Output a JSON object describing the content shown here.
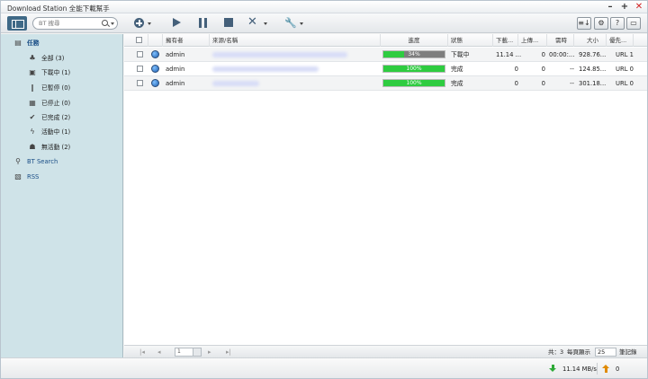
{
  "window": {
    "title": "Download Station 全能下載幫手",
    "controls": [
      "–",
      "+",
      "✕"
    ]
  },
  "toolbar": {
    "search_placeholder": "BT 搜尋",
    "right_buttons": [
      "≡↓",
      "⚙",
      "?",
      "▭"
    ]
  },
  "sidebar": {
    "tasks_header": "任務",
    "items": [
      {
        "label": "全部 (3)",
        "icon": "all-users-icon"
      },
      {
        "label": "下載中 (1)",
        "icon": "downloading-icon"
      },
      {
        "label": "已暫停 (0)",
        "icon": "paused-icon"
      },
      {
        "label": "已停止 (0)",
        "icon": "stopped-icon"
      },
      {
        "label": "已完成 (2)",
        "icon": "check-icon"
      },
      {
        "label": "活動中 (1)",
        "icon": "active-icon"
      },
      {
        "label": "無活動 (2)",
        "icon": "inactive-icon"
      }
    ],
    "bt_search": "BT Search",
    "rss": "RSS"
  },
  "table": {
    "headers": [
      "擁有者",
      "來源/名稱",
      "進度",
      "狀態",
      "下載...",
      "上傳...",
      "需時",
      "大小",
      "優先..."
    ],
    "rows": [
      {
        "owner": "admin",
        "progress": 0.34,
        "progress_text": "34%",
        "status": "下載中",
        "down": "11.14 ...",
        "up": "0",
        "eta": "00:00:...",
        "size": "928.76...",
        "priority": "URL 1"
      },
      {
        "owner": "admin",
        "progress": 1.0,
        "progress_text": "100%",
        "status": "完成",
        "down": "0",
        "up": "0",
        "eta": "--",
        "size": "124.85...",
        "priority": "URL 0"
      },
      {
        "owner": "admin",
        "progress": 1.0,
        "progress_text": "100%",
        "status": "完成",
        "down": "0",
        "up": "0",
        "eta": "--",
        "size": "301.18...",
        "priority": "URL 0"
      }
    ]
  },
  "pager": {
    "page": "1",
    "total": "共：3",
    "per_page_label": "每頁顯示",
    "per_page_value": "25",
    "records_label": "筆記錄"
  },
  "status": {
    "download_speed": "11.14 MB/s",
    "upload_speed": "0"
  }
}
